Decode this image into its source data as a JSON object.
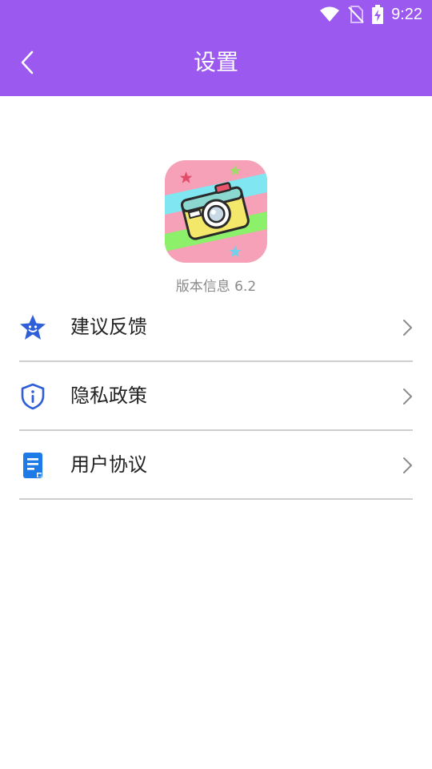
{
  "status_bar": {
    "time": "9:22",
    "icons": [
      "wifi-icon",
      "no-sim-icon",
      "battery-charging-icon"
    ]
  },
  "header": {
    "title": "设置",
    "back_icon": "back-arrow-icon"
  },
  "app": {
    "icon": "camera-app-icon",
    "version_text": "版本信息 6.2"
  },
  "menu": {
    "items": [
      {
        "label": "建议反馈",
        "icon": "star-smile-icon"
      },
      {
        "label": "隐私政策",
        "icon": "shield-info-icon"
      },
      {
        "label": "用户协议",
        "icon": "document-icon"
      }
    ]
  },
  "colors": {
    "primary": "#9b59ef",
    "icon_blue": "#2f6bdc"
  }
}
